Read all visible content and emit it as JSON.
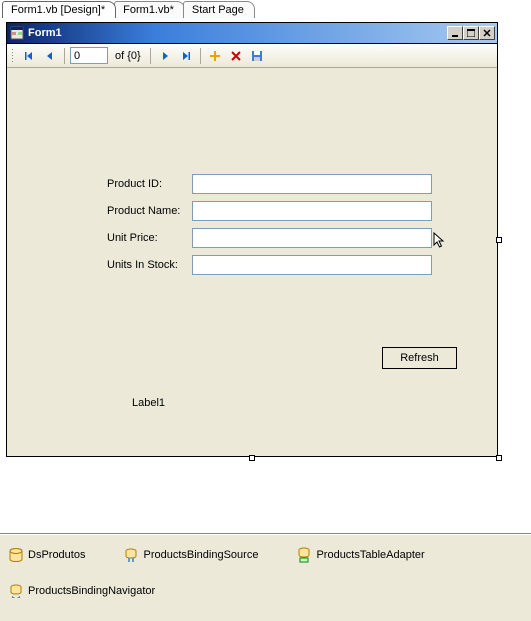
{
  "tabs": [
    {
      "label": "Form1.vb [Design]*",
      "active": true
    },
    {
      "label": "Form1.vb*",
      "active": false
    },
    {
      "label": "Start Page",
      "active": false
    }
  ],
  "form": {
    "title": "Form1",
    "navigator": {
      "position": "0",
      "count_text": "of {0}"
    },
    "fields": [
      {
        "label": "Product ID:",
        "value": ""
      },
      {
        "label": "Product Name:",
        "value": ""
      },
      {
        "label": "Unit Price:",
        "value": ""
      },
      {
        "label": "Units In Stock:",
        "value": ""
      }
    ],
    "label1": "Label1",
    "refresh_label": "Refresh"
  },
  "components": [
    {
      "name": "DsProdutos"
    },
    {
      "name": "ProductsBindingSource"
    },
    {
      "name": "ProductsTableAdapter"
    },
    {
      "name": "ProductsBindingNavigator"
    }
  ]
}
